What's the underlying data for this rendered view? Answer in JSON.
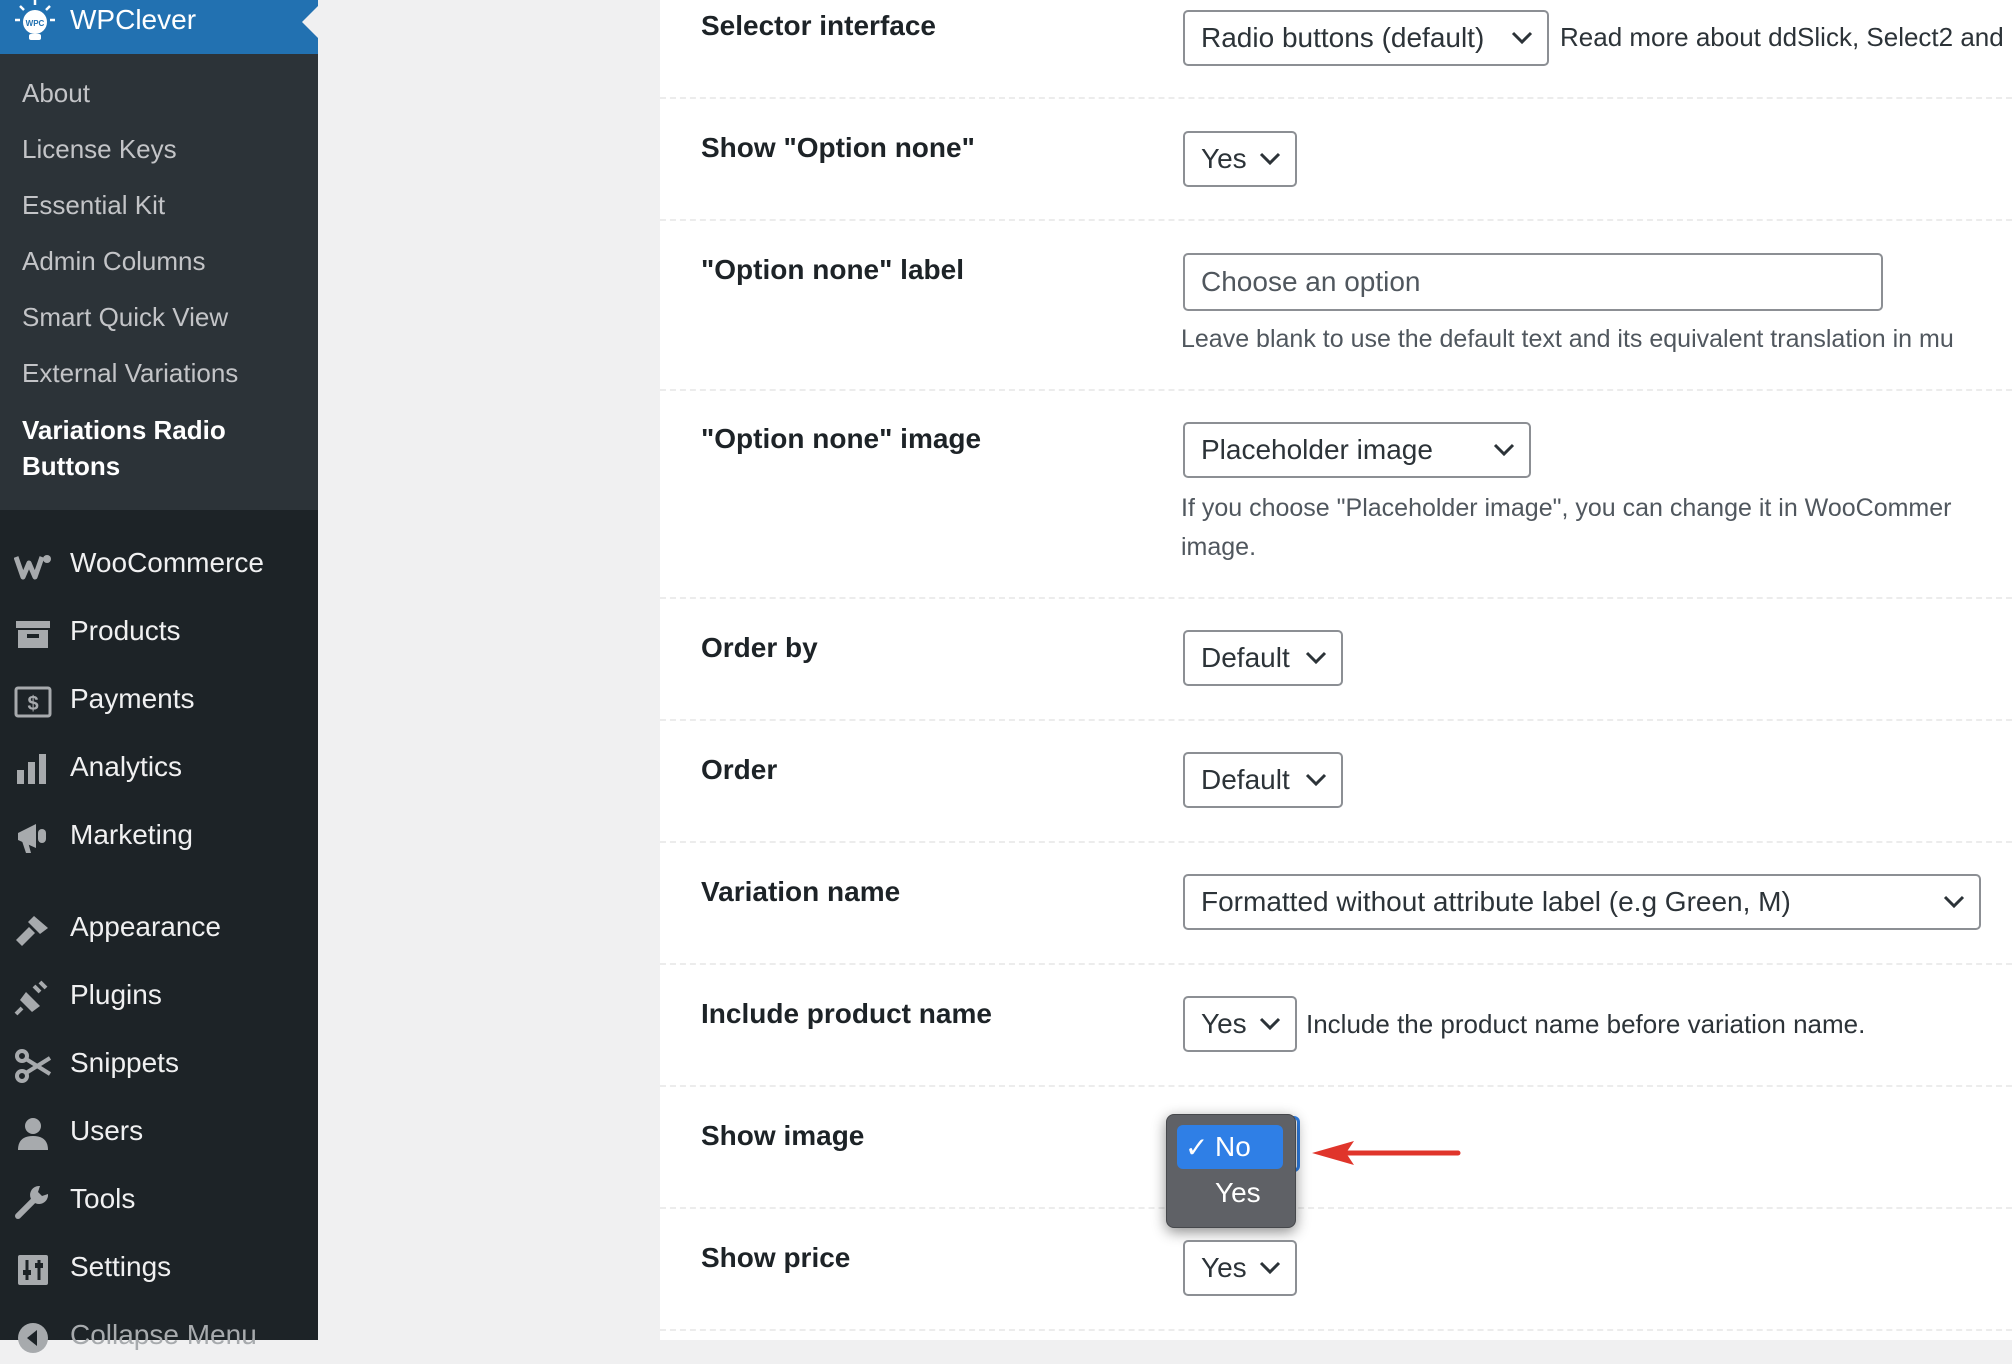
{
  "sidebar": {
    "brand": "WPClever",
    "logo_text": "WPC",
    "submenu": [
      {
        "label": "About"
      },
      {
        "label": "License Keys"
      },
      {
        "label": "Essential Kit"
      },
      {
        "label": "Admin Columns"
      },
      {
        "label": "Smart Quick View"
      },
      {
        "label": "External Variations"
      },
      {
        "label": "Variations Radio Buttons",
        "current": true
      }
    ],
    "menu": [
      {
        "label": "WooCommerce",
        "icon": "woocommerce-icon"
      },
      {
        "label": "Products",
        "icon": "products-icon"
      },
      {
        "label": "Payments",
        "icon": "payments-icon"
      },
      {
        "label": "Analytics",
        "icon": "analytics-icon"
      },
      {
        "label": "Marketing",
        "icon": "marketing-icon"
      },
      {
        "label": "Appearance",
        "icon": "appearance-icon"
      },
      {
        "label": "Plugins",
        "icon": "plugins-icon"
      },
      {
        "label": "Snippets",
        "icon": "snippets-icon"
      },
      {
        "label": "Users",
        "icon": "users-icon"
      },
      {
        "label": "Tools",
        "icon": "tools-icon"
      },
      {
        "label": "Settings",
        "icon": "settings-icon"
      },
      {
        "label": "Collapse Menu",
        "icon": "collapse-icon"
      }
    ]
  },
  "settings": {
    "selector_interface": {
      "label": "Selector interface",
      "value": "Radio buttons (default)",
      "note": "Read more about ddSlick, Select2 and"
    },
    "show_option_none": {
      "label": "Show \"Option none\"",
      "value": "Yes"
    },
    "option_none_label": {
      "label": "\"Option none\" label",
      "placeholder": "Choose an option",
      "note": "Leave blank to use the default text and its equivalent translation in mu"
    },
    "option_none_image": {
      "label": "\"Option none\" image",
      "value": "Placeholder image",
      "note_line1": "If you choose \"Placeholder image\", you can change it in WooCommer",
      "note_line2": "image."
    },
    "order_by": {
      "label": "Order by",
      "value": "Default"
    },
    "order": {
      "label": "Order",
      "value": "Default"
    },
    "variation_name": {
      "label": "Variation name",
      "value": "Formatted without attribute label (e.g Green, M)"
    },
    "include_product_name": {
      "label": "Include product name",
      "value": "Yes",
      "note": "Include the product name before variation name."
    },
    "show_image": {
      "label": "Show image",
      "options": [
        "No",
        "Yes"
      ],
      "selected": "No",
      "check": "✓"
    },
    "show_price": {
      "label": "Show price",
      "value": "Yes"
    }
  },
  "colors": {
    "sidebar_bg": "#1d2327",
    "submenu_bg": "#2c3338",
    "brand_bg": "#2271b1",
    "selected_option": "#2f7fe6",
    "annotation_arrow": "#e0352b"
  }
}
